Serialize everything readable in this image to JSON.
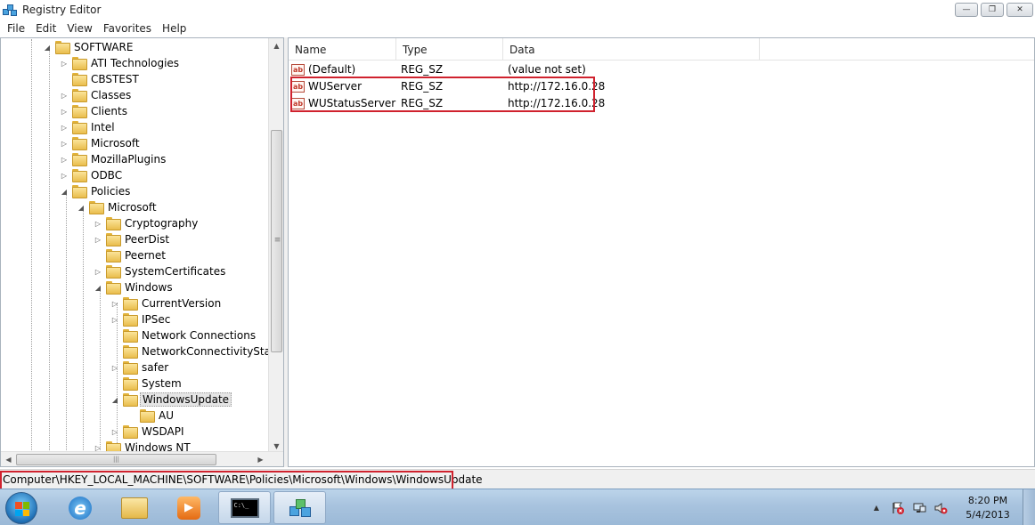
{
  "window": {
    "title": "Registry Editor",
    "controls": {
      "minimize": "—",
      "maximize": "❐",
      "close": "✕"
    }
  },
  "menu": [
    "File",
    "Edit",
    "View",
    "Favorites",
    "Help"
  ],
  "tree": {
    "items": [
      {
        "label": "SOFTWARE",
        "expander": "◢",
        "level": 0
      },
      {
        "label": "ATI Technologies",
        "expander": "▷",
        "level": 1
      },
      {
        "label": "CBSTEST",
        "expander": "",
        "level": 1
      },
      {
        "label": "Classes",
        "expander": "▷",
        "level": 1
      },
      {
        "label": "Clients",
        "expander": "▷",
        "level": 1
      },
      {
        "label": "Intel",
        "expander": "▷",
        "level": 1
      },
      {
        "label": "Microsoft",
        "expander": "▷",
        "level": 1
      },
      {
        "label": "MozillaPlugins",
        "expander": "▷",
        "level": 1
      },
      {
        "label": "ODBC",
        "expander": "▷",
        "level": 1
      },
      {
        "label": "Policies",
        "expander": "◢",
        "level": 1
      },
      {
        "label": "Microsoft",
        "expander": "◢",
        "level": 2
      },
      {
        "label": "Cryptography",
        "expander": "▷",
        "level": 3
      },
      {
        "label": "PeerDist",
        "expander": "▷",
        "level": 3
      },
      {
        "label": "Peernet",
        "expander": "",
        "level": 3
      },
      {
        "label": "SystemCertificates",
        "expander": "▷",
        "level": 3
      },
      {
        "label": "Windows",
        "expander": "◢",
        "level": 3
      },
      {
        "label": "CurrentVersion",
        "expander": "▷",
        "level": 4
      },
      {
        "label": "IPSec",
        "expander": "▷",
        "level": 4
      },
      {
        "label": "Network Connections",
        "expander": "",
        "level": 4
      },
      {
        "label": "NetworkConnectivityStatusIndicator",
        "expander": "",
        "level": 4
      },
      {
        "label": "safer",
        "expander": "▷",
        "level": 4
      },
      {
        "label": "System",
        "expander": "",
        "level": 4
      },
      {
        "label": "WindowsUpdate",
        "expander": "◢",
        "level": 4,
        "selected": true
      },
      {
        "label": "AU",
        "expander": "",
        "level": 5
      },
      {
        "label": "WSDAPI",
        "expander": "▷",
        "level": 4
      },
      {
        "label": "Windows NT",
        "expander": "▷",
        "level": 3
      }
    ],
    "scroll": {
      "up": "▲",
      "down": "▼",
      "left": "◀",
      "right": "▶",
      "grip": "|||",
      "vgrip": "≡"
    }
  },
  "list": {
    "columns": [
      "Name",
      "Type",
      "Data"
    ],
    "icon_text": "ab",
    "rows": [
      {
        "name": "(Default)",
        "type": "REG_SZ",
        "data": "(value not set)"
      },
      {
        "name": "WUServer",
        "type": "REG_SZ",
        "data": "http://172.16.0.28"
      },
      {
        "name": "WUStatusServer",
        "type": "REG_SZ",
        "data": "http://172.16.0.28"
      }
    ]
  },
  "status": {
    "path": "Computer\\HKEY_LOCAL_MACHINE\\SOFTWARE\\Policies\\Microsoft\\Windows\\WindowsUpdate"
  },
  "taskbar": {
    "apps": [
      {
        "name": "internet-explorer",
        "icon": "e"
      },
      {
        "name": "file-explorer",
        "icon": ""
      },
      {
        "name": "media-player",
        "icon": "▶"
      },
      {
        "name": "command-prompt",
        "icon": "C:\\_"
      },
      {
        "name": "registry-editor",
        "icon": ""
      }
    ],
    "tray": {
      "show_hidden": "▲"
    },
    "clock": {
      "time": "8:20 PM",
      "date": "5/4/2013"
    }
  },
  "colors": {
    "highlight_box": "#d0222e",
    "taskbar": "#a8c3de"
  }
}
